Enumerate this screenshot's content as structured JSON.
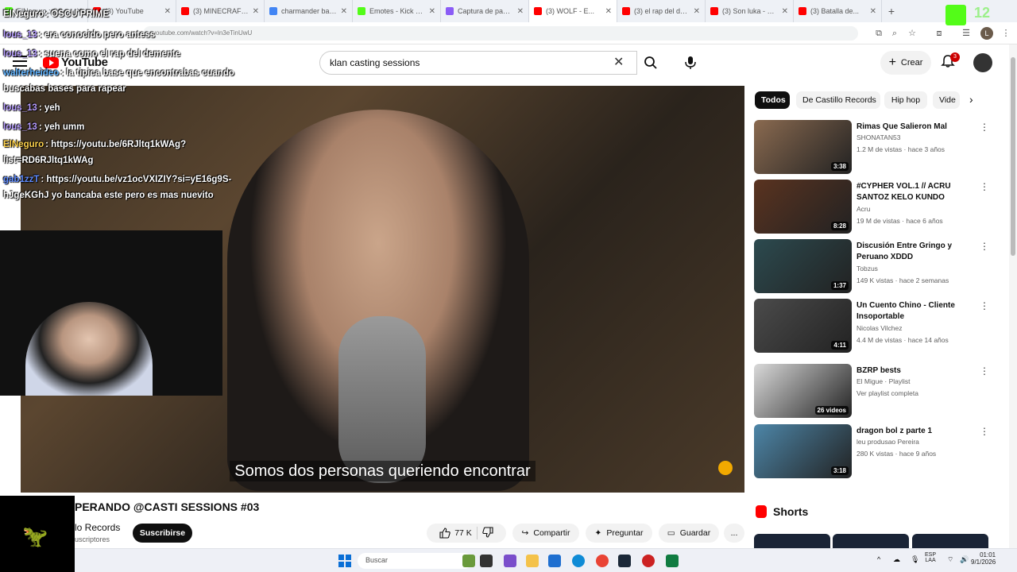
{
  "browser": {
    "tabs": [
      {
        "label": "ElNeguro : OSCU PRIME",
        "fav": "#53fc18"
      },
      {
        "label": "(3) YouTube",
        "fav": "#ff0000"
      },
      {
        "label": "(3) MINECRAFT R...",
        "fav": "#ff0000"
      },
      {
        "label": "charmander badg...",
        "fav": "#4285f4"
      },
      {
        "label": "Emotes - Kick Do...",
        "fav": "#53fc18"
      },
      {
        "label": "Captura de panta...",
        "fav": "#8b5cf6"
      },
      {
        "label": "(3) WOLF - E...",
        "fav": "#ff0000"
      },
      {
        "label": "(3) el rap del dem...",
        "fav": "#ff0000"
      },
      {
        "label": "(3) Son luka - De...",
        "fav": "#ff0000"
      },
      {
        "label": "(3) Batalla de...",
        "fav": "#ff0000"
      }
    ],
    "new_tab": "+",
    "address": "youtube.com/watch?v=ln3eTinUwU",
    "kick_badge": "12"
  },
  "youtube": {
    "logo": "YouTube",
    "search_value": "klan casting sessions",
    "create_label": "Crear",
    "notif_count": "3"
  },
  "chat": [
    {
      "user": "ElNeguro",
      "text": ": OSCU PRIME",
      "color": "#ffffff"
    },
    {
      "user": "lous_13",
      "text": ": era conocido pero antess",
      "color": "#b69cff"
    },
    {
      "user": "lous_13",
      "text": ": suena como el rap del demente",
      "color": "#b69cff"
    },
    {
      "user": "walterheideo",
      "text": ": la tipica base que encontrabas cuando",
      "color": "#5fb3ff"
    },
    {
      "user": "",
      "text": "buscabas bases para rapear",
      "color": "#ffffff"
    },
    {
      "user": "lous_13",
      "text": ": yeh",
      "color": "#b69cff"
    },
    {
      "user": "lous_13",
      "text": ": yeh umm",
      "color": "#b69cff"
    },
    {
      "user": "ElNeguro",
      "text": ": https://youtu.be/6RJltq1kWAg?",
      "color": "#ffd34d"
    },
    {
      "user": "",
      "text": "list=RD6RJltq1kWAg",
      "color": "#ffffff"
    },
    {
      "user": "gab1zzT",
      "text": ": https://youtu.be/vz1ocVXIZIY?si=yE16g9S-",
      "color": "#5f8cff"
    },
    {
      "user": "",
      "text": "hJgeKGhJ yo bancaba este pero es mas nuevito",
      "color": "#ffffff"
    }
  ],
  "video": {
    "subtitle": "Somos dos personas queriendo encontrar",
    "title": "PERANDO @CASTI SESSIONS #03",
    "channel": "lo Records",
    "subs": "uscriptores",
    "subscribe_label": "Suscribirse",
    "likes": "77 K",
    "share_label": "Compartir",
    "ask_label": "Preguntar",
    "save_label": "Guardar",
    "more_label": "..."
  },
  "chips": [
    "Todos",
    "De Castillo Records",
    "Hip hop",
    "Vide"
  ],
  "recommendations": [
    {
      "title": "Rimas Que Salieron Mal",
      "channel": "SHONATAN53",
      "meta": "1.2 M de vistas · hace 3 años",
      "duration": "3:38",
      "color": "#8a6a50"
    },
    {
      "title": "#CYPHER VOL.1 // ACRU SANTOZ KELO KUNDO BRAPI...",
      "channel": "Acru",
      "meta": "19 M de vistas · hace 6 años",
      "duration": "8:28",
      "color": "#5a3320"
    },
    {
      "title": "Discusión Entre Gringo y Peruano XDDD",
      "channel": "Tobzus",
      "meta": "149 K vistas · hace 2 semanas",
      "duration": "1:37",
      "color": "#2c4a4f"
    },
    {
      "title": "Un Cuento Chino - Cliente Insoportable",
      "channel": "Nicolas Vilchez",
      "meta": "4.4 M de vistas · hace 14 años",
      "duration": "4:11",
      "color": "#4b4b4b"
    },
    {
      "title": "BZRP bests",
      "channel": "El Migue · Playlist",
      "meta": "Ver playlist completa",
      "duration": "26 videos",
      "color": "#d9d9d9"
    },
    {
      "title": "dragon bol z parte 1",
      "channel": "leu produsao Pereira",
      "meta": "280 K vistas · hace 9 años",
      "duration": "3:18",
      "color": "#4d86a8"
    }
  ],
  "shorts_label": "Shorts",
  "taskbar": {
    "search": "Buscar",
    "lang": "ESP\nLAA",
    "time": "01:01",
    "date": "9/1/2026"
  }
}
